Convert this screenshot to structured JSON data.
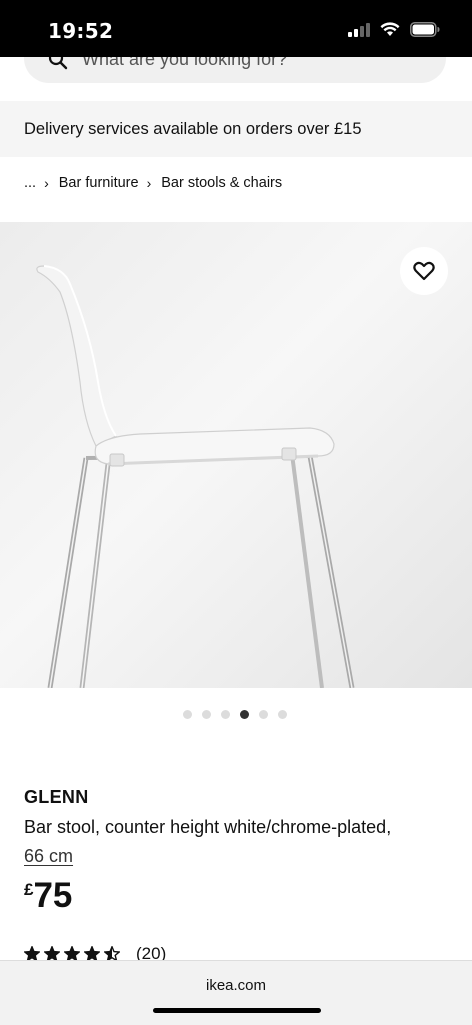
{
  "status_bar": {
    "time": "19:52"
  },
  "search": {
    "placeholder": "What are you looking for?"
  },
  "banner": {
    "delivery_text": "Delivery services available on orders over £15"
  },
  "breadcrumb": {
    "items": [
      "...",
      "Bar furniture",
      "Bar stools & chairs"
    ]
  },
  "gallery": {
    "image_count": 6,
    "active_index": 3
  },
  "product": {
    "name": "GLENN",
    "description": "Bar stool, counter height white/chrome-plated,",
    "size": "66 cm",
    "currency": "£",
    "price": "75",
    "rating_value": 4.5,
    "rating_count": "(20)"
  },
  "browser": {
    "url": "ikea.com"
  },
  "icons": {
    "search": "search-icon",
    "favorite": "heart-icon",
    "chevron": "chevron-right-icon",
    "star": "star-icon"
  }
}
